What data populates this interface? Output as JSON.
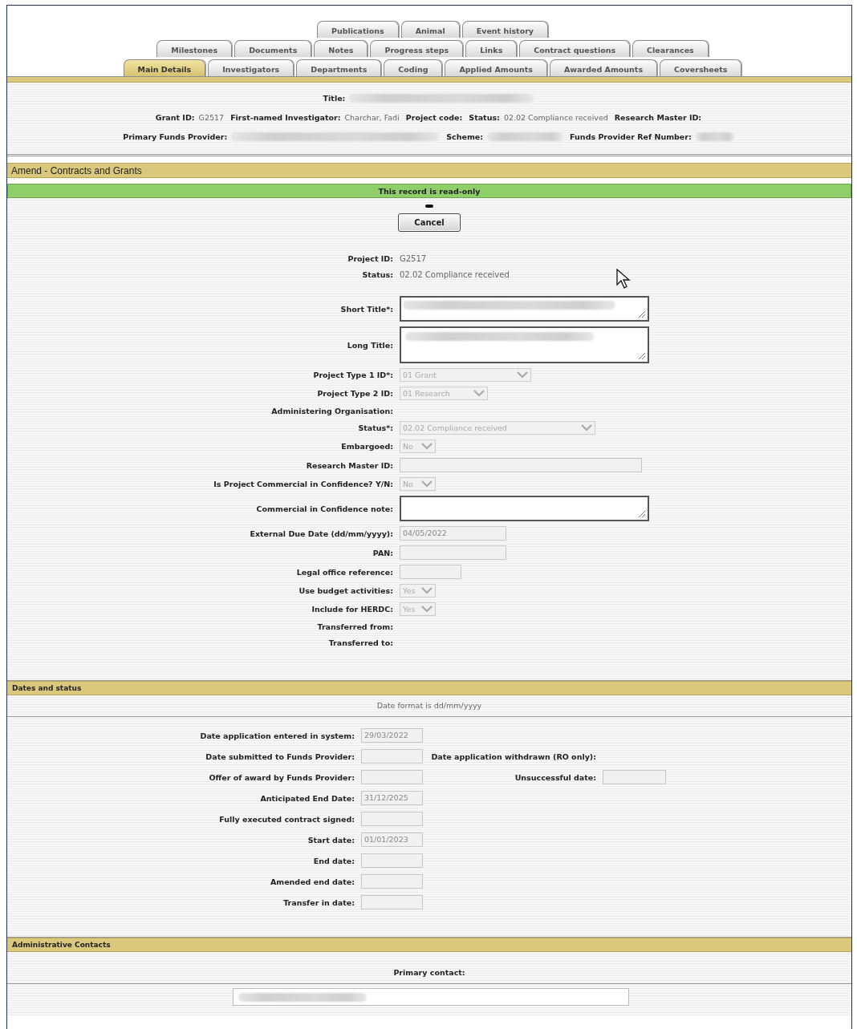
{
  "tabs": {
    "tab_rows": [
      {
        "tabs": [
          {
            "label": "Publications",
            "selected": false
          },
          {
            "label": "Animal",
            "selected": false
          },
          {
            "label": "Event history",
            "selected": false
          }
        ]
      },
      {
        "tabs": [
          {
            "label": "Milestones",
            "selected": false
          },
          {
            "label": "Documents",
            "selected": false
          },
          {
            "label": "Notes",
            "selected": false
          },
          {
            "label": "Progress steps",
            "selected": false
          },
          {
            "label": "Links",
            "selected": false
          },
          {
            "label": "Contract questions",
            "selected": false
          },
          {
            "label": "Clearances",
            "selected": false
          }
        ]
      },
      {
        "tabs": [
          {
            "label": "Main Details",
            "selected": true
          },
          {
            "label": "Investigators",
            "selected": false
          },
          {
            "label": "Departments",
            "selected": false
          },
          {
            "label": "Coding",
            "selected": false
          },
          {
            "label": "Applied Amounts",
            "selected": false
          },
          {
            "label": "Awarded Amounts",
            "selected": false
          },
          {
            "label": "Coversheets",
            "selected": false
          }
        ]
      }
    ]
  },
  "record_header": {
    "lines": [
      {
        "items": [
          {
            "label": "Title:",
            "redacted": true
          }
        ]
      },
      {
        "items": [
          {
            "label": "Grant ID:",
            "value": "G2517"
          },
          {
            "label": "First-named Investigator:",
            "value": "Charchar, Fadi"
          },
          {
            "label": "Project code:"
          },
          {
            "label": "Status:",
            "value": "02.02 Compliance received"
          },
          {
            "label": "Research Master ID:"
          }
        ]
      },
      {
        "items": [
          {
            "label": "Primary Funds Provider:",
            "redacted": true
          },
          {
            "label": "Scheme:",
            "redacted": true
          },
          {
            "label": "Funds Provider Ref Number:",
            "redacted": true
          }
        ]
      }
    ]
  },
  "amend": {
    "title": "Amend - Contracts and Grants",
    "notice": "This record is read-only",
    "cancel_button": "Cancel",
    "fields": [
      {
        "kind": "display",
        "label": "Project ID:",
        "value": "G2517"
      },
      {
        "kind": "display",
        "label": "Status:",
        "value": "02.02 Compliance received"
      },
      {
        "kind": "textarea",
        "label": "Short Title*:",
        "redacted": true
      },
      {
        "kind": "textarea",
        "label": "Long Title:",
        "redacted": true
      },
      {
        "kind": "select",
        "label": "Project Type 1 ID*:",
        "value": "01 Grant"
      },
      {
        "kind": "select",
        "label": "Project Type 2 ID:",
        "value": "01 Research"
      },
      {
        "kind": "label",
        "label": "Administering Organisation:"
      },
      {
        "kind": "select",
        "label": "Status*:",
        "value": "02.02 Compliance received"
      },
      {
        "kind": "select",
        "label": "Embargoed:",
        "value": "No"
      },
      {
        "kind": "input",
        "label": "Research Master ID:"
      },
      {
        "kind": "select",
        "label": "Is Project Commercial in Confidence? Y/N:",
        "value": "No"
      },
      {
        "kind": "textarea",
        "label": "Commercial in Confidence note:",
        "redacted": false
      },
      {
        "kind": "input",
        "label": "External Due Date (dd/mm/yyyy):",
        "value": "04/05/2022"
      },
      {
        "kind": "input",
        "label": "PAN:"
      },
      {
        "kind": "input",
        "label": "Legal office reference:"
      },
      {
        "kind": "select",
        "label": "Use budget activities:",
        "value": "Yes"
      },
      {
        "kind": "select",
        "label": "Include for HERDC:",
        "value": "Yes"
      },
      {
        "kind": "label",
        "label": "Transferred from:"
      },
      {
        "kind": "label",
        "label": "Transferred to:"
      }
    ]
  },
  "dates": {
    "title": "Dates and status",
    "note": "Date format is dd/mm/yyyy",
    "rows": [
      {
        "label": "Date application entered in system:",
        "value": "29/03/2022"
      },
      {
        "label": "Date submitted to Funds Provider:",
        "side": {
          "kind": "label",
          "label": "Date application withdrawn (RO only):"
        }
      },
      {
        "label": "Offer of award by Funds Provider:",
        "side": {
          "kind": "field",
          "label": "Unsuccessful date:"
        }
      },
      {
        "label": "Anticipated End Date:",
        "value": "31/12/2025"
      },
      {
        "label": "Fully executed contract signed:"
      },
      {
        "label": "Start date:",
        "value": "01/01/2023"
      },
      {
        "label": "End date:"
      },
      {
        "label": "Amended end date:"
      },
      {
        "label": "Transfer in date:"
      }
    ]
  },
  "contacts": {
    "title": "Administrative Contacts",
    "label": "Primary contact:",
    "field": {
      "redacted": true
    }
  }
}
